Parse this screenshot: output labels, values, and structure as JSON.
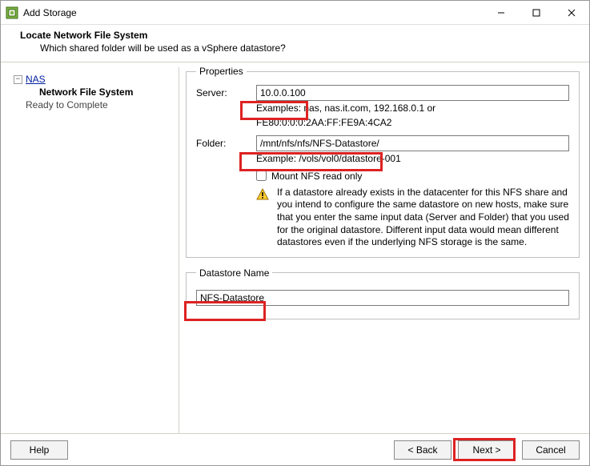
{
  "window": {
    "title": "Add Storage"
  },
  "header": {
    "title": "Locate Network File System",
    "subtitle": "Which shared folder will be used as a vSphere datastore?"
  },
  "sidebar": {
    "root_label": "NAS",
    "child_label": "Network File System",
    "child2_label": "Ready to Complete",
    "toggle_glyph": "−"
  },
  "properties": {
    "legend": "Properties",
    "server_label": "Server:",
    "server_value": "10.0.0.100",
    "server_hint1": "Examples: nas, nas.it.com, 192.168.0.1 or",
    "server_hint2": "FE80:0:0:0:2AA:FF:FE9A:4CA2",
    "folder_label": "Folder:",
    "folder_value": "/mnt/nfs/nfs/NFS-Datastore/",
    "folder_hint": "Example: /vols/vol0/datastore-001",
    "mount_ro_label": "Mount NFS read only",
    "warning_text": "If a datastore already exists in the datacenter for this NFS share and you intend to configure the same datastore on new hosts, make sure that you enter the same input data (Server and Folder) that you used for the original datastore. Different input data would mean different datastores even if the underlying NFS storage is the same."
  },
  "datastore": {
    "legend": "Datastore Name",
    "value": "NFS-Datastore"
  },
  "buttons": {
    "help": "Help",
    "back": "< Back",
    "next": "Next >",
    "cancel": "Cancel"
  }
}
